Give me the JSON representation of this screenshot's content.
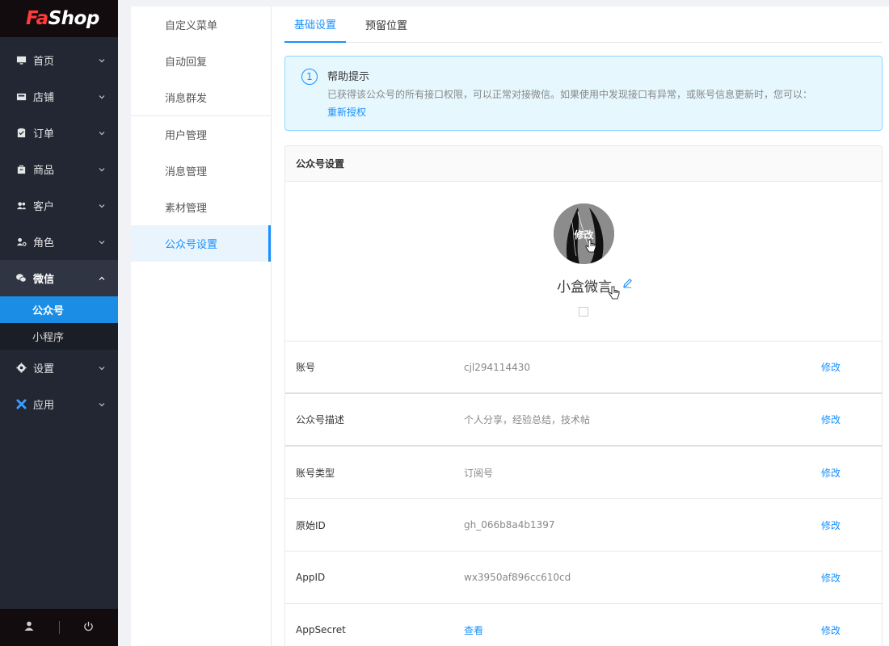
{
  "brand": {
    "part1": "Fa",
    "part2": "Shop"
  },
  "sidebar": {
    "items": [
      {
        "label": "首页",
        "icon": "monitor-icon"
      },
      {
        "label": "店铺",
        "icon": "store-icon"
      },
      {
        "label": "订单",
        "icon": "clipboard-icon"
      },
      {
        "label": "商品",
        "icon": "bag-icon"
      },
      {
        "label": "客户",
        "icon": "users-icon"
      },
      {
        "label": "角色",
        "icon": "role-icon"
      },
      {
        "label": "微信",
        "icon": "wechat-icon",
        "sub": [
          "公众号",
          "小程序"
        ]
      },
      {
        "label": "设置",
        "icon": "gear-icon"
      },
      {
        "label": "应用",
        "icon": "apps-icon"
      }
    ]
  },
  "submenu": {
    "items": [
      "自定义菜单",
      "自动回复",
      "消息群发",
      "用户管理",
      "消息管理",
      "素材管理",
      "公众号设置"
    ]
  },
  "tabs": [
    "基础设置",
    "预留位置"
  ],
  "alert": {
    "title": "帮助提示",
    "desc": "已获得该公众号的所有接口权限，可以正常对接微信。如果使用中发现接口有异常，或账号信息更新时，您可以：",
    "link": "重新授权"
  },
  "card": {
    "title": "公众号设置",
    "avatar_label": "修改",
    "name": "小盒微言",
    "rows": [
      {
        "label": "账号",
        "value": "cjl294114430",
        "action": "修改"
      },
      {
        "label": "公众号描述",
        "value": "个人分享，经验总结，技术帖",
        "action": "修改"
      },
      {
        "label": "账号类型",
        "value": "订阅号",
        "action": "修改"
      },
      {
        "label": "原始ID",
        "value": "gh_066b8a4b1397",
        "action": "修改"
      },
      {
        "label": "AppID",
        "value": "wx3950af896cc610cd",
        "action": "修改"
      },
      {
        "label": "AppSecret",
        "value": "查看",
        "action": "修改"
      }
    ]
  },
  "colors": {
    "accent": "#1890ff",
    "sidebar_bg": "#222733",
    "brand_red": "#ff3b3b"
  }
}
